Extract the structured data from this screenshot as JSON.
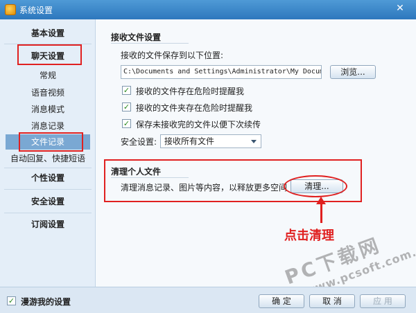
{
  "window": {
    "title": "系统设置",
    "close_glyph": "✕"
  },
  "sidebar": {
    "categories": [
      "基本设置",
      "聊天设置",
      "个性设置",
      "安全设置",
      "订阅设置"
    ],
    "sub_items": [
      "常规",
      "语音视频",
      "消息模式",
      "消息记录",
      "文件记录",
      "自动回复、快捷短语"
    ],
    "selected_sub": "文件记录"
  },
  "receive": {
    "section_title": "接收文件设置",
    "save_location_label": "接收的文件保存到以下位置:",
    "path_value": "C:\\Documents and Settings\\Administrator\\My Docum",
    "browse_label": "浏览...",
    "checkboxes": [
      {
        "label": "接收的文件存在危险时提醒我",
        "checked": true
      },
      {
        "label": "接收的文件夹存在危险时提醒我",
        "checked": true
      },
      {
        "label": "保存未接收完的文件以便下次续传",
        "checked": true
      }
    ],
    "check_glyph": "✓",
    "security_label": "安全设置:",
    "security_value": "接收所有文件"
  },
  "cleanup": {
    "section_title": "清理个人文件",
    "description": "清理消息记录、图片等内容，以释放更多空间",
    "button_label": "清理..."
  },
  "annotation": {
    "text": "点击清理",
    "color": "#e02020"
  },
  "watermark": {
    "line1": "PC下载网",
    "line2": "www.pcsoft.com.cn"
  },
  "footer": {
    "roam_label": "漫游我的设置",
    "roam_checked": true,
    "ok_label": "确 定",
    "cancel_label": "取 消",
    "apply_label": "应 用"
  }
}
